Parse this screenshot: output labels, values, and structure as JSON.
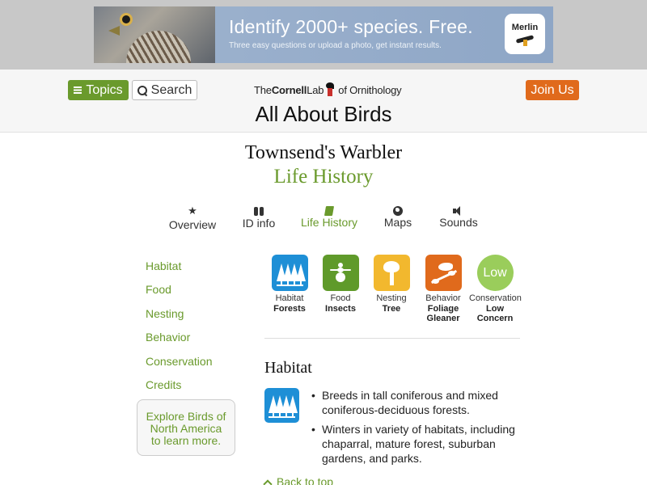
{
  "ad": {
    "headline": "Identify 2000+ species. Free.",
    "subtext": "Three easy questions or upload a photo, get instant results.",
    "app_name": "Merlin"
  },
  "header": {
    "topics_label": "Topics",
    "search_label": "Search",
    "logo": {
      "prefix": "The",
      "name": "Cornell",
      "lab": "Lab",
      "suffix": "of Ornithology"
    },
    "site_title": "All About Birds",
    "join_label": "Join Us"
  },
  "species": {
    "name": "Townsend's Warbler",
    "section": "Life History"
  },
  "tabs": [
    {
      "label": "Overview",
      "icon": "star-icon"
    },
    {
      "label": "ID info",
      "icon": "binoculars-icon"
    },
    {
      "label": "Life History",
      "icon": "book-icon",
      "active": true
    },
    {
      "label": "Maps",
      "icon": "globe-icon"
    },
    {
      "label": "Sounds",
      "icon": "speaker-icon"
    }
  ],
  "sidebar": {
    "links": [
      "Habitat",
      "Food",
      "Nesting",
      "Behavior",
      "Conservation",
      "Credits"
    ],
    "explore_line1": "Explore Birds of",
    "explore_line2": "North America",
    "explore_line3": "to learn more."
  },
  "facts": [
    {
      "category": "Habitat",
      "value": "Forests",
      "icon": "forest-icon",
      "color": "#1e8fd6"
    },
    {
      "category": "Food",
      "value": "Insects",
      "icon": "insect-icon",
      "color": "#5f9a2a"
    },
    {
      "category": "Nesting",
      "value": "Tree",
      "icon": "tree-icon",
      "color": "#f2b82e"
    },
    {
      "category": "Behavior",
      "value_line1": "Foliage",
      "value_line2": "Gleaner",
      "icon": "bird-on-branch-icon",
      "color": "#e06a1c"
    },
    {
      "category": "Conservation",
      "badge": "Low",
      "value_line1": "Low",
      "value_line2": "Concern",
      "color": "#9acd5b"
    }
  ],
  "habitat": {
    "heading": "Habitat",
    "bullets": [
      "Breeds in tall coniferous and mixed coniferous-deciduous forests.",
      "Winters in variety of habitats, including chaparral, mature forest, suburban gardens, and parks."
    ]
  },
  "back_to_top": "Back to top",
  "colors": {
    "accent_green": "#6a9a2c",
    "join_orange": "#e06a1c",
    "habitat_blue": "#1e8fd6"
  }
}
